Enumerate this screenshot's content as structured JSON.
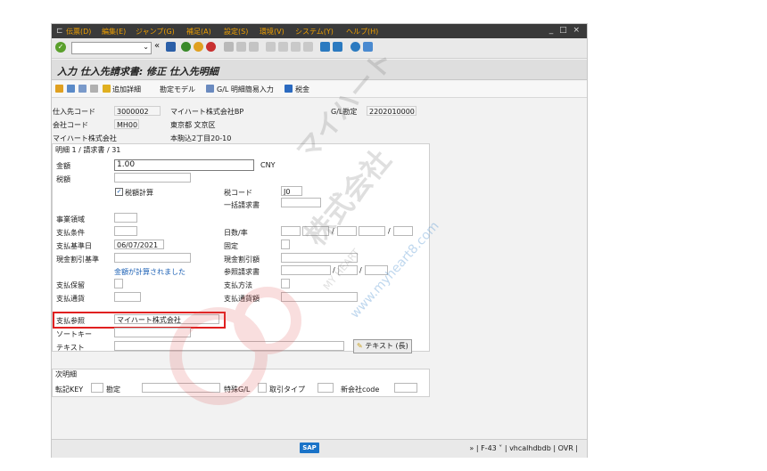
{
  "menu": {
    "items": [
      "伝票(D)",
      "編集(E)",
      "ジャンプ(G)",
      "補足(A)",
      "設定(S)",
      "環境(V)",
      "システム(Y)",
      "ヘルプ(H)"
    ],
    "window_controls": "_ □ ×"
  },
  "toolbar": {
    "back_symbol": "«"
  },
  "title": "入力 仕入先請求書: 修正 仕入先明細",
  "appbar": {
    "add_detail": "追加詳細",
    "acct_model": "勘定モデル",
    "gl_fast": "G/L 明細簡易入力",
    "tax": "税金"
  },
  "header": {
    "vendor_code_label": "仕入先コード",
    "vendor_code": "3000002",
    "vendor_name": "マイハート株式会社BP",
    "gl_label": "G/L勘定",
    "gl_value": "2202010000",
    "company_code_label": "会社コード",
    "company_code": "MH00",
    "city": "東京都 文京区",
    "company_name": "マイハート株式会社",
    "address": "本駒込2丁目20-10"
  },
  "item": {
    "heading": "明細 1 / 請求書 / 31",
    "amount_label": "金額",
    "amount": "1.00",
    "currency": "CNY",
    "tax_amount_label": "税額",
    "calc_tax_label": "税額計算",
    "tax_code_label": "税コード",
    "tax_code": "J0",
    "lump_invoice_label": "一括請求書",
    "business_area_label": "事業領域",
    "payment_terms_label": "支払条件",
    "days_rate_label": "日数/率",
    "baseline_date_label": "支払基準日",
    "baseline_date": "06/07/2021",
    "fixed_label": "固定",
    "cash_discount_base_label": "現金割引基準",
    "cash_discount_amount_label": "現金割引額",
    "tax_calculated_msg": "金額が計算されました",
    "reference_invoice_label": "参照請求書",
    "payment_block_label": "支払保留",
    "payment_method_label": "支払方法",
    "payment_currency_label": "支払通貨",
    "payment_currency_amount_label": "支払通貨額",
    "payment_reference_label": "支払参照",
    "payment_reference": "マイハート株式会社",
    "sort_key_label": "ソートキー",
    "text_label": "テキスト",
    "long_text_button": "テキスト (長)",
    "slash": "/"
  },
  "next_item": {
    "heading": "次明細",
    "posting_key_label": "転記KEY",
    "account_label": "勘定",
    "special_gl_label": "特殊G/L",
    "transaction_type_label": "取引タイプ",
    "new_company_label": "新会社code"
  },
  "status": {
    "sap_logo": "SAP",
    "info": "» | F-43 ˅ | vhcalhdbdb | OVR |"
  },
  "watermark": {
    "line1": "マイハート",
    "line2": "株式会社",
    "en": "MY HEART",
    "url": "www.myheart8.com"
  },
  "colors": {
    "menu_bg": "#3a3a3a",
    "menu_text": "#f0a000",
    "highlight": "#e02020",
    "link": "#1a5fb4"
  }
}
